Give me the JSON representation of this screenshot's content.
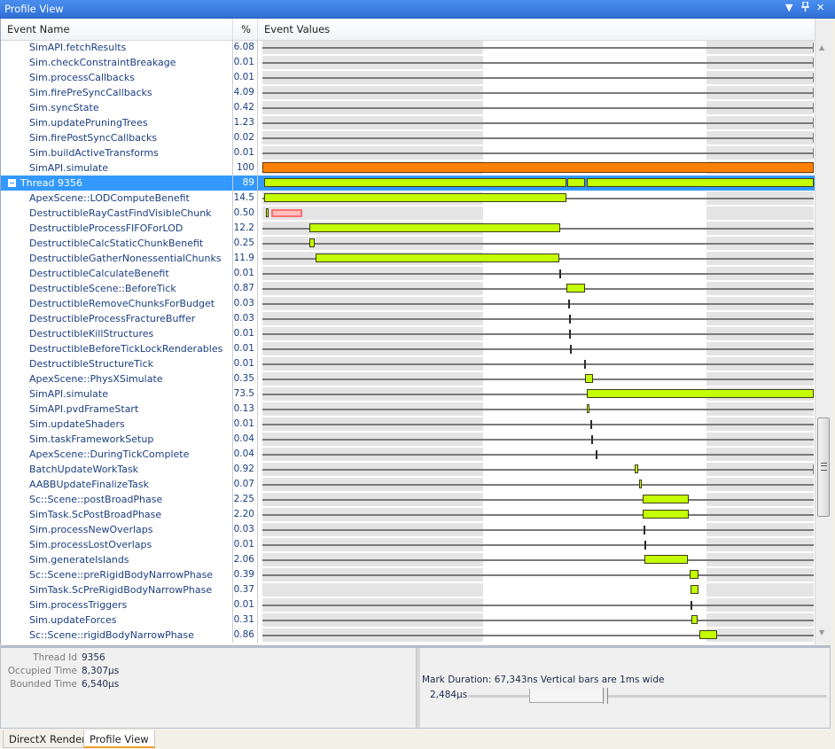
{
  "window": {
    "title": "Profile View",
    "controls": {
      "dropdown": "▼",
      "pin": "ᵖ",
      "close": "✕"
    }
  },
  "columns": {
    "name": "Event Name",
    "percent": "%",
    "values": "Event Values"
  },
  "rows": [
    {
      "name": "SimAPI.fetchResults",
      "pct": "6.08",
      "type": "line",
      "line_start": 0.0,
      "line_end": 1.0,
      "end_tick": true
    },
    {
      "name": "Sim.checkConstraintBreakage",
      "pct": "0.01",
      "type": "line",
      "line_start": 0.0,
      "line_end": 1.0,
      "end_tick": true
    },
    {
      "name": "Sim.processCallbacks",
      "pct": "0.01",
      "type": "line",
      "line_start": 0.0,
      "line_end": 1.0,
      "end_tick": true
    },
    {
      "name": "Sim.firePreSyncCallbacks",
      "pct": "4.09",
      "type": "line",
      "line_start": 0.0,
      "line_end": 1.0,
      "end_tick": true
    },
    {
      "name": "Sim.syncState",
      "pct": "0.42",
      "type": "line",
      "line_start": 0.0,
      "line_end": 1.0,
      "end_tick": true
    },
    {
      "name": "Sim.updatePruningTrees",
      "pct": "1.23",
      "type": "line",
      "line_start": 0.0,
      "line_end": 1.0,
      "end_tick": true
    },
    {
      "name": "Sim.firePostSyncCallbacks",
      "pct": "0.02",
      "type": "line",
      "line_start": 0.0,
      "line_end": 1.0,
      "end_tick": true
    },
    {
      "name": "Sim.buildActiveTransforms",
      "pct": "0.01",
      "type": "line",
      "line_start": 0.0,
      "line_end": 1.0,
      "end_tick": true
    },
    {
      "name": "SimAPI.simulate",
      "pct": "100",
      "type": "bars",
      "bars": [
        {
          "start": 0.0,
          "end": 1.0,
          "color": "orange"
        }
      ]
    },
    {
      "name": "Thread 9356",
      "pct": "89",
      "type": "bars",
      "selected": true,
      "expander": "collapse",
      "bars": [
        {
          "start": 0.003,
          "end": 0.551
        },
        {
          "start": 0.553,
          "end": 0.586
        },
        {
          "start": 0.588,
          "end": 1.0
        }
      ]
    },
    {
      "name": "ApexScene::LODComputeBenefit",
      "pct": "14.5",
      "type": "bars",
      "line_start": 0.0,
      "line_end": 1.0,
      "bars": [
        {
          "start": 0.003,
          "end": 0.551
        }
      ]
    },
    {
      "name": "DestructibleRayCastFindVisibleChunk",
      "pct": "0.50",
      "type": "bars",
      "bars": [
        {
          "start": 0.007,
          "end": 0.012
        },
        {
          "start": 0.016,
          "end": 0.072,
          "color": "pink"
        }
      ]
    },
    {
      "name": "DestructibleProcessFIFOForLOD",
      "pct": "12.2",
      "type": "bars",
      "line_start": 0.0,
      "line_end": 1.0,
      "bars": [
        {
          "start": 0.085,
          "end": 0.54
        }
      ]
    },
    {
      "name": "DestructibleCalcStaticChunkBenefit",
      "pct": "0.25",
      "type": "bars",
      "line_start": 0.0,
      "line_end": 1.0,
      "bars": [
        {
          "start": 0.085,
          "end": 0.095
        }
      ]
    },
    {
      "name": "DestructibleGatherNonessentialChunks",
      "pct": "11.9",
      "type": "bars",
      "line_start": 0.0,
      "line_end": 1.0,
      "bars": [
        {
          "start": 0.096,
          "end": 0.539
        }
      ]
    },
    {
      "name": "DestructibleCalculateBenefit",
      "pct": "0.01",
      "type": "ticks",
      "line_start": 0.0,
      "line_end": 1.0,
      "ticks": [
        0.538
      ]
    },
    {
      "name": "DestructibleScene::BeforeTick",
      "pct": "0.87",
      "type": "bars",
      "line_start": 0.0,
      "line_end": 1.0,
      "bars": [
        {
          "start": 0.552,
          "end": 0.585
        }
      ]
    },
    {
      "name": "DestructibleRemoveChunksForBudget",
      "pct": "0.03",
      "type": "ticks",
      "line_start": 0.0,
      "line_end": 1.0,
      "ticks": [
        0.554
      ]
    },
    {
      "name": "DestructibleProcessFractureBuffer",
      "pct": "0.03",
      "type": "ticks",
      "line_start": 0.0,
      "line_end": 1.0,
      "ticks": [
        0.556
      ]
    },
    {
      "name": "DestructibleKillStructures",
      "pct": "0.01",
      "type": "ticks",
      "line_start": 0.0,
      "line_end": 1.0,
      "ticks": [
        0.557
      ]
    },
    {
      "name": "DestructibleBeforeTickLockRenderables",
      "pct": "0.01",
      "type": "ticks",
      "line_start": 0.0,
      "line_end": 1.0,
      "ticks": [
        0.558
      ]
    },
    {
      "name": "DestructibleStructureTick",
      "pct": "0.01",
      "type": "ticks",
      "line_start": 0.0,
      "line_end": 1.0,
      "ticks": [
        0.584
      ]
    },
    {
      "name": "ApexScene::PhysXSimulate",
      "pct": "0.35",
      "type": "bars",
      "line_start": 0.0,
      "line_end": 1.0,
      "bars": [
        {
          "start": 0.586,
          "end": 0.6
        }
      ]
    },
    {
      "name": "SimAPI.simulate",
      "pct": "73.5",
      "type": "bars",
      "line_start": 0.0,
      "line_end": 1.0,
      "bars": [
        {
          "start": 0.588,
          "end": 1.0
        }
      ]
    },
    {
      "name": "SimAPI.pvdFrameStart",
      "pct": "0.13",
      "type": "bars",
      "line_start": 0.0,
      "line_end": 1.0,
      "bars": [
        {
          "start": 0.588,
          "end": 0.594
        }
      ]
    },
    {
      "name": "Sim.updateShaders",
      "pct": "0.01",
      "type": "ticks",
      "line_start": 0.0,
      "line_end": 1.0,
      "ticks": [
        0.595
      ]
    },
    {
      "name": "Sim.taskFrameworkSetup",
      "pct": "0.04",
      "type": "ticks",
      "line_start": 0.0,
      "line_end": 1.0,
      "ticks": [
        0.597
      ]
    },
    {
      "name": "ApexScene::DuringTickComplete",
      "pct": "0.04",
      "type": "ticks",
      "line_start": 0.0,
      "line_end": 1.0,
      "ticks": [
        0.604
      ]
    },
    {
      "name": "BatchUpdateWorkTask",
      "pct": "0.92",
      "type": "bars",
      "line_start": 0.0,
      "line_end": 1.0,
      "end_tick": true,
      "bars": [
        {
          "start": 0.676,
          "end": 0.682
        }
      ]
    },
    {
      "name": "AABBUpdateFinalizeTask",
      "pct": "0.07",
      "type": "bars",
      "line_start": 0.0,
      "line_end": 1.0,
      "bars": [
        {
          "start": 0.684,
          "end": 0.688
        }
      ]
    },
    {
      "name": "Sc::Scene::postBroadPhase",
      "pct": "2.25",
      "type": "bars",
      "line_start": 0.0,
      "line_end": 1.0,
      "bars": [
        {
          "start": 0.689,
          "end": 0.774
        }
      ]
    },
    {
      "name": "SimTask.ScPostBroadPhase",
      "pct": "2.20",
      "type": "bars",
      "line_start": 0.0,
      "line_end": 1.0,
      "bars": [
        {
          "start": 0.69,
          "end": 0.774
        }
      ]
    },
    {
      "name": "Sim.processNewOverlaps",
      "pct": "0.03",
      "type": "ticks",
      "line_start": 0.0,
      "line_end": 1.0,
      "ticks": [
        0.691
      ]
    },
    {
      "name": "Sim.processLostOverlaps",
      "pct": "0.01",
      "type": "ticks",
      "line_start": 0.0,
      "line_end": 1.0,
      "ticks": [
        0.693
      ]
    },
    {
      "name": "Sim.generateIslands",
      "pct": "2.06",
      "type": "bars",
      "line_start": 0.0,
      "line_end": 1.0,
      "bars": [
        {
          "start": 0.693,
          "end": 0.772
        }
      ]
    },
    {
      "name": "Sc::Scene::preRigidBodyNarrowPhase",
      "pct": "0.39",
      "type": "bars",
      "line_start": 0.0,
      "line_end": 1.0,
      "bars": [
        {
          "start": 0.775,
          "end": 0.791
        }
      ]
    },
    {
      "name": "SimTask.ScPreRigidBodyNarrowPhase",
      "pct": "0.37",
      "type": "bars",
      "bars": [
        {
          "start": 0.776,
          "end": 0.791
        }
      ]
    },
    {
      "name": "Sim.processTriggers",
      "pct": "0.01",
      "type": "ticks",
      "line_start": 0.0,
      "line_end": 1.0,
      "ticks": [
        0.776
      ]
    },
    {
      "name": "Sim.updateForces",
      "pct": "0.31",
      "type": "bars",
      "line_start": 0.0,
      "line_end": 1.0,
      "bars": [
        {
          "start": 0.778,
          "end": 0.79
        }
      ]
    },
    {
      "name": "Sc::Scene::rigidBodyNarrowPhase",
      "pct": "0.86",
      "type": "bars",
      "line_start": 0.0,
      "line_end": 1.0,
      "bars": [
        {
          "start": 0.792,
          "end": 0.825
        }
      ]
    }
  ],
  "timeline": {
    "highlight_window": {
      "start": 0.4,
      "end": 0.806
    },
    "colors": {
      "bar": "#c3ff00",
      "root_bar": "#ff8000",
      "overlay": "#ffc0c0",
      "band": "#e4e4e4",
      "selected_row": "#3399ff"
    }
  },
  "details": {
    "thread_id_label": "Thread Id",
    "thread_id": "9356",
    "occupied_label": "Occupied Time",
    "occupied": "8,307µs",
    "bounded_label": "Bounded Time",
    "bounded": "6,540µs"
  },
  "zoom": {
    "mark_duration": "Mark Duration: 67,343ns  Vertical bars are 1ms wide",
    "window_value": "2,484µs",
    "range_start": 0.17,
    "range_end": 0.38
  },
  "tabs": [
    {
      "label": "DirectX Render",
      "active": false
    },
    {
      "label": "Profile View",
      "active": true
    }
  ]
}
